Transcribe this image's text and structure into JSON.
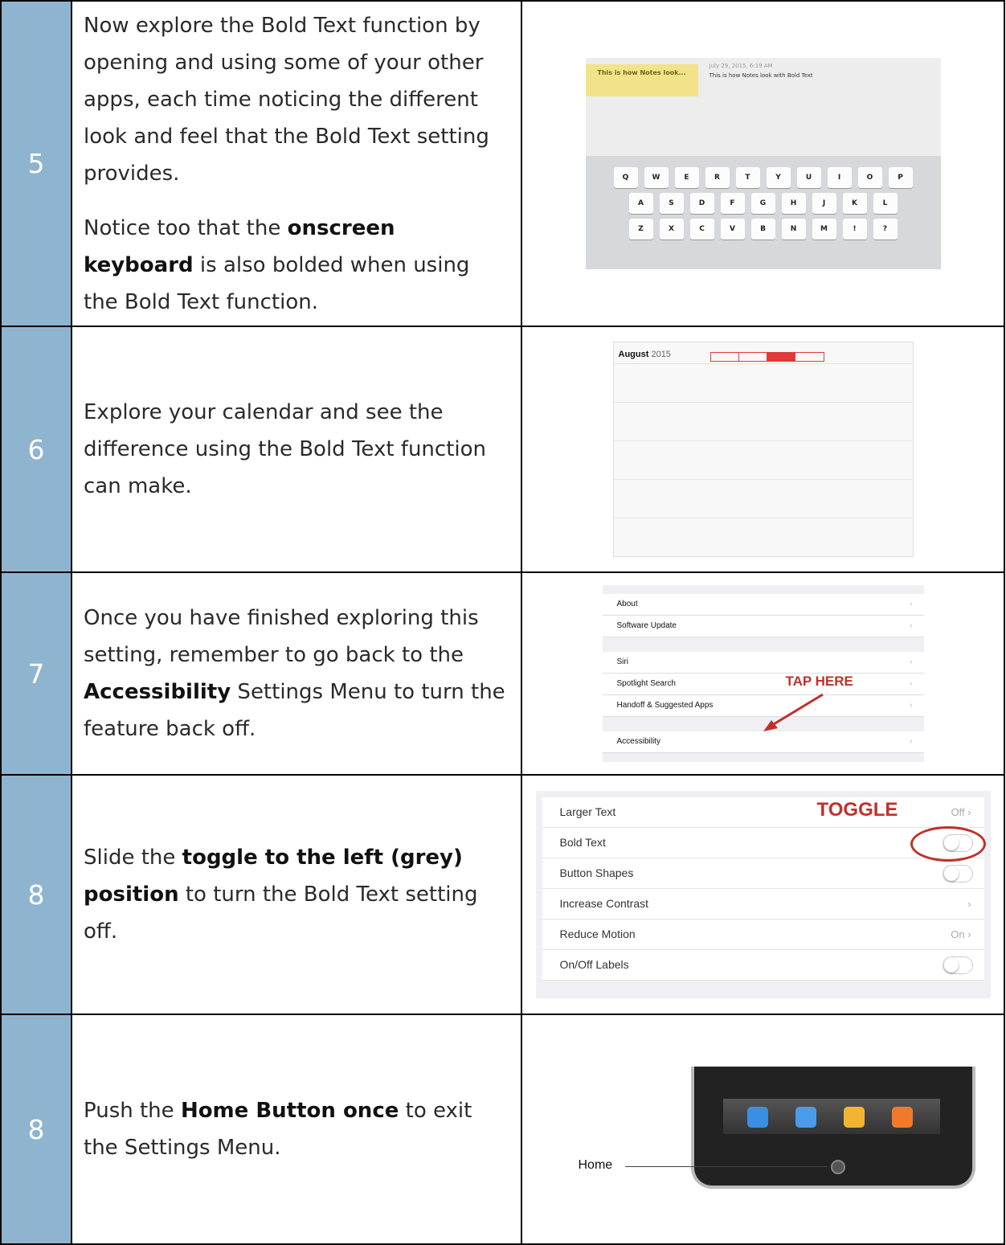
{
  "rows": [
    {
      "num": "5",
      "p1": "Now explore the Bold Text function by opening and using some of your other apps, each time noticing the different look and feel that the Bold Text setting provides.",
      "p2a": "Notice too that the ",
      "p2b": "onscreen keyboard",
      "p2c": " is also bolded when using the Bold Text function.",
      "notes_title": "This is how Notes look...",
      "notes_date": "July 29, 2015, 6:19 AM",
      "notes_line": "This is how Notes look with Bold Text",
      "keys_row1": [
        "Q",
        "W",
        "E",
        "R",
        "T",
        "Y",
        "U",
        "I",
        "O",
        "P"
      ],
      "keys_row2": [
        "A",
        "S",
        "D",
        "F",
        "G",
        "H",
        "J",
        "K",
        "L"
      ],
      "keys_row3": [
        "Z",
        "X",
        "C",
        "V",
        "B",
        "N",
        "M",
        "!",
        "?"
      ]
    },
    {
      "num": "6",
      "text": "Explore your calendar and see the difference using the Bold Text function can make.",
      "cal_month": "August",
      "cal_year": "2015"
    },
    {
      "num": "7",
      "a": "Once you have finished exploring this setting, remember to go back to the ",
      "b": "Accessibility",
      "c": " Settings Menu to turn the feature back off.",
      "group1": [
        "About",
        "Software Update"
      ],
      "group2": [
        "Siri",
        "Spotlight Search",
        "Handoff & Suggested Apps"
      ],
      "group3": [
        "Accessibility"
      ],
      "callout": "TAP HERE"
    },
    {
      "num": "8",
      "a": "Slide the ",
      "b": "toggle to the left (grey) position",
      "c": " to turn the Bold Text setting off.",
      "settings": [
        {
          "label": "Larger Text",
          "value": "Off"
        },
        {
          "label": "Bold Text",
          "value": ""
        },
        {
          "label": "Button Shapes",
          "value": ""
        },
        {
          "label": "Increase Contrast",
          "value": ""
        },
        {
          "label": "Reduce Motion",
          "value": "On"
        },
        {
          "label": "On/Off Labels",
          "value": ""
        }
      ],
      "callout": "TOGGLE"
    },
    {
      "num": "8",
      "a": "Push the ",
      "b": "Home Button once",
      "c": " to exit the Settings Menu.",
      "home_label": "Home"
    }
  ]
}
